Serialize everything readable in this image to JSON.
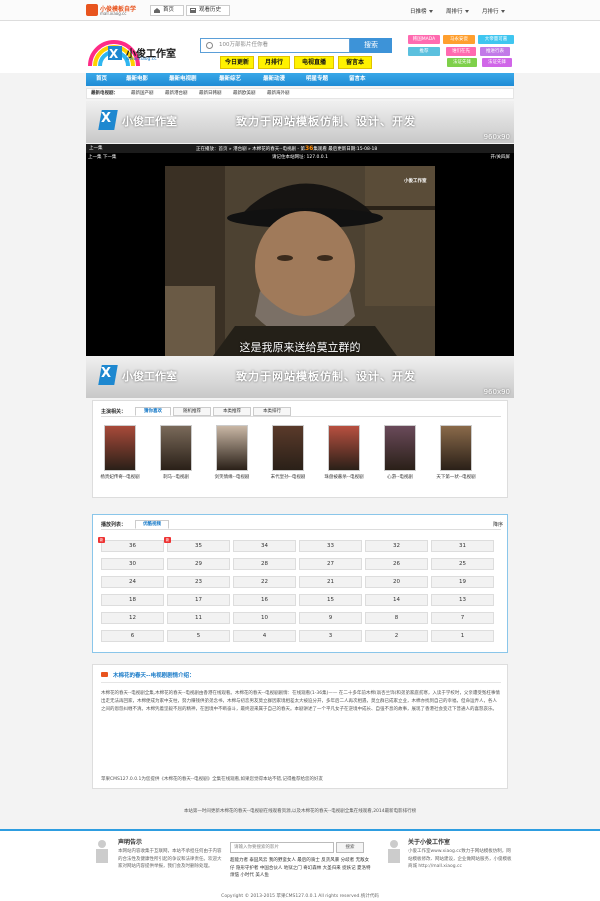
{
  "topbar": {
    "logo_name": "小俊模板自学",
    "logo_url": "mall.xiaog.cc",
    "home": "首页",
    "history": "观看历史",
    "menu_recommend": "日推榜",
    "menu_weekly": "周排行",
    "menu_monthly": "月排行"
  },
  "header": {
    "logo_brand": "小俊工作室",
    "logo_url": "www.xiaog.cc",
    "search_placeholder": "100万部影片任你看",
    "search_button": "搜索",
    "quick_links": [
      "今日更新",
      "月排行",
      "电视直播",
      "留言本"
    ],
    "tags": [
      "韩国MADA",
      "马永安瓷",
      "大帝量可嘉",
      "推荐",
      "谁们在先",
      "推进行表",
      "法证先锋",
      "法证先锋"
    ]
  },
  "mainnav": [
    "首页",
    "最新电影",
    "最新电视剧",
    "最新综艺",
    "最新动漫",
    "明星专题",
    "留言本"
  ],
  "subnav": {
    "label": "最新电视剧：",
    "items": [
      "最新国产剧",
      "最新港台剧",
      "最新日韩剧",
      "最新欧美剧",
      "最新海外剧"
    ]
  },
  "banner": {
    "brand": "小俊工作室",
    "slogan": "致力于网站模板仿制、设计、开发",
    "size": "960x90"
  },
  "playbar": {
    "prev": "上一集",
    "now_playing": "正在播放：",
    "home": "首页",
    "category": "港台剧",
    "title": "木棉花的春天--电视剧",
    "ep_prefix": "第",
    "ep_number": "36",
    "ep_suffix": "集观看",
    "update_label": "最后更新日期",
    "update_date": "15-08-18"
  },
  "player": {
    "nav": "上一集 下一集",
    "ip_text": "请记住本站网址: 127.0.0.1",
    "fullscreen": "开/关四屏",
    "subtitle": "这是我原来送给莫立群的",
    "watermark": "小俊工作室"
  },
  "related": {
    "label": "主演相关：",
    "tabs": [
      "猜你喜欢",
      "随机推荐",
      "本类推荐",
      "本类排行"
    ],
    "items": [
      {
        "title": "杨贵妃传奇--电视剧",
        "color": "#a84a3a"
      },
      {
        "title": "刺马--电视剧",
        "color": "#7a6a5a"
      },
      {
        "title": "剑笑情缘--电视剧",
        "color": "#c9b7a5"
      },
      {
        "title": "末代皇孙--电视剧",
        "color": "#5a3a2a"
      },
      {
        "title": "珠盘被蔽杀--电视剧",
        "color": "#b85040"
      },
      {
        "title": "心游--电视剧",
        "color": "#6a4a5a"
      },
      {
        "title": "天下第一状--电视剧",
        "color": "#8a6a4a"
      }
    ]
  },
  "playlist": {
    "label": "播放列表：",
    "tab": "优酷视频",
    "sort": "降序",
    "new_badge": "新",
    "episodes": [
      "36",
      "35",
      "34",
      "33",
      "32",
      "31",
      "30",
      "29",
      "28",
      "27",
      "26",
      "25",
      "24",
      "23",
      "22",
      "21",
      "20",
      "19",
      "18",
      "17",
      "16",
      "15",
      "14",
      "13",
      "12",
      "11",
      "10",
      "9",
      "8",
      "7",
      "6",
      "5",
      "4",
      "3",
      "2",
      "1"
    ]
  },
  "intro": {
    "title": "木棉花的春天--电视剧剧情介绍：",
    "paragraph": "木棉花的春天--电视剧全集,木棉花的春天--电视剧由香港在线观看。木棉花的春天--电视剧剧情：在线观看(1-36集)——  在二十多年前木棉(翁杏兰饰)和弟弟家庭贫寒，入读于学校时，父亲遭受冤枉事情出走无法再回家，木棉便成为家中支柱，努力赚钱供弟弟念书，木棉与初恋男友莫立群因家境相差太大被迫分开，多年后二人再次相遇，莫立群已成家立业，木棉亦找到自己的幸福，但命运弄人，各人之间的恩怨纠缠不清。木棉凭着坚毅不屈的精神，在困境中不断奋斗，最终迎来属于自己的春天。本剧讲述了一个平凡女子在逆境中成长、自强不息的故事，展现了香港社会变迁下普通人的喜怒哀乐。",
    "note": "苹果CMS127.0.0.1为您提供《木棉花的春天--电视剧》全集在线观看,如果您觉得本站不错,记得推荐给您的好友"
  },
  "disclaimer": "本站第一时间更新木棉花的春天--电视剧在线观看资源,以及木棉花的春天--电视剧全集在线观看,2014最新电影排行榜",
  "footer": {
    "statement_title": "声明告示",
    "statement_text": "本网站内容收集于互联网，本站不承担任何由于内容的合法性及健康性所引起的争议和法律责任。欢迎大家对网站内容提供举报，我们会及时删除处理。",
    "search_placeholder": "请输入你要搜索的影片",
    "search_button": "搜索",
    "hotwords": "超能力者 泰囧风云 我的野蛮女人 最后的骑士 反贪风暴 分歧者 无敌女仔 隐形守护者 中国合伙人 地狱之门 奇幻森林 大圣归来 捉妖记 夏洛特烦恼 小时代 美人鱼",
    "about_title": "关于小俊工作室",
    "about_text": "小俊工作室www.xiaog.cc致力于网站模板仿制，网站模板修改、网站建设，企业做网站服务，小俊模板商城 http://mall.xiaog.cc",
    "copyright": "Copyright © 2013-2015 苹果CMS127.0.0.1 All rights reserved.统计代码"
  },
  "colors": {
    "accent": "#1e8bd5",
    "quick_yellow": "#fff200",
    "tag_colors": [
      "#ff6ab0",
      "#ff9f2e",
      "#3fc6f0",
      "#5bc0de",
      "#ff6ab0",
      "#c27ae8",
      "#7ed04a",
      "#d066e8"
    ]
  }
}
